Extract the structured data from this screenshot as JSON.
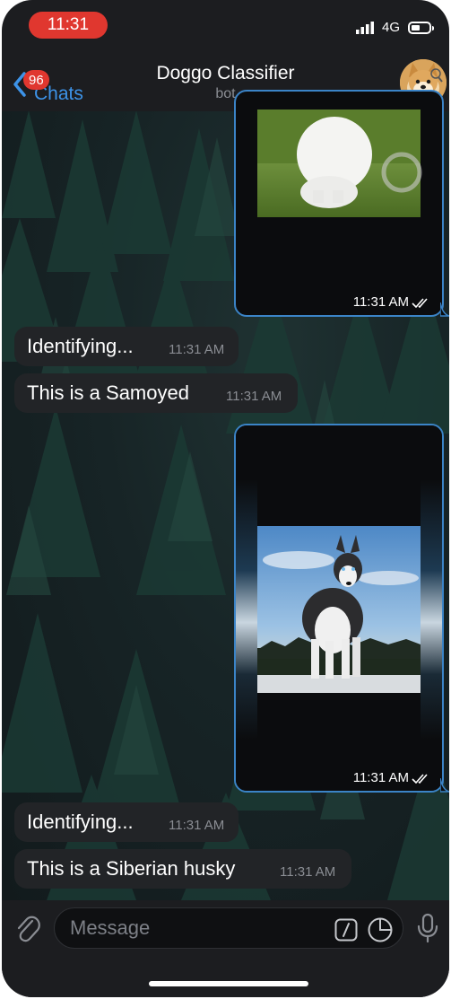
{
  "status_bar": {
    "time": "11:31",
    "network": "4G"
  },
  "nav": {
    "back_label": "Chats",
    "unread_badge": "96",
    "title": "Doggo Classifier",
    "subtitle": "bot",
    "avatar_icon": "shiba-dog-avatar"
  },
  "messages": [
    {
      "type": "photo",
      "direction": "outgoing",
      "subject": "samoyed-photo",
      "time": "11:31 AM",
      "status": "read"
    },
    {
      "type": "text",
      "direction": "incoming",
      "text": "Identifying...",
      "time": "11:31 AM"
    },
    {
      "type": "text",
      "direction": "incoming",
      "text": "This is a Samoyed",
      "time": "11:31 AM"
    },
    {
      "type": "photo",
      "direction": "outgoing",
      "subject": "siberian-husky-photo",
      "time": "11:31 AM",
      "status": "read"
    },
    {
      "type": "text",
      "direction": "incoming",
      "text": "Identifying...",
      "time": "11:31 AM"
    },
    {
      "type": "text",
      "direction": "incoming",
      "text": "This is a Siberian husky",
      "time": "11:31 AM"
    }
  ],
  "composer": {
    "placeholder": "Message",
    "icons": [
      "paperclip-icon",
      "bot-command-icon",
      "sticker-icon",
      "microphone-icon"
    ]
  },
  "colors": {
    "accent": "#3d93e8",
    "badge": "#e0372f",
    "outgoing_border": "#3b84c7",
    "incoming_bubble": "#222427",
    "background": "#1c1d20"
  }
}
